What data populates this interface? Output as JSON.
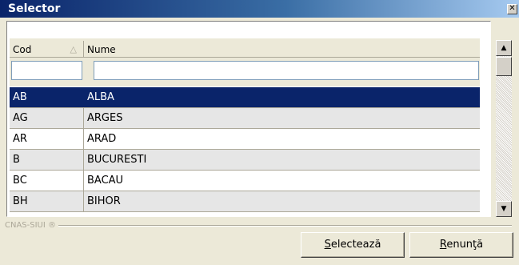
{
  "window": {
    "title": "Selector",
    "close_glyph": "✕"
  },
  "grid": {
    "columns": [
      {
        "label": "Cod",
        "sorted": "ascending"
      },
      {
        "label": "Nume"
      }
    ],
    "filters": {
      "cod_value": "",
      "nume_value": ""
    },
    "rows": [
      {
        "cod": "AB",
        "nume": "ALBA",
        "selected": true
      },
      {
        "cod": "AG",
        "nume": "ARGES"
      },
      {
        "cod": "AR",
        "nume": "ARAD"
      },
      {
        "cod": "B",
        "nume": "BUCURESTI"
      },
      {
        "cod": "BC",
        "nume": "BACAU"
      },
      {
        "cod": "BH",
        "nume": "BIHOR"
      }
    ]
  },
  "footer": {
    "brand": "CNAS-SIUI ®"
  },
  "buttons": {
    "select": {
      "accel": "S",
      "rest": "electează"
    },
    "cancel": {
      "accel": "R",
      "rest": "enunţă"
    }
  },
  "colors": {
    "selected_row": "#0a246a",
    "alt_row": "#e6e6e6",
    "title_gradient_start": "#0a246a"
  }
}
